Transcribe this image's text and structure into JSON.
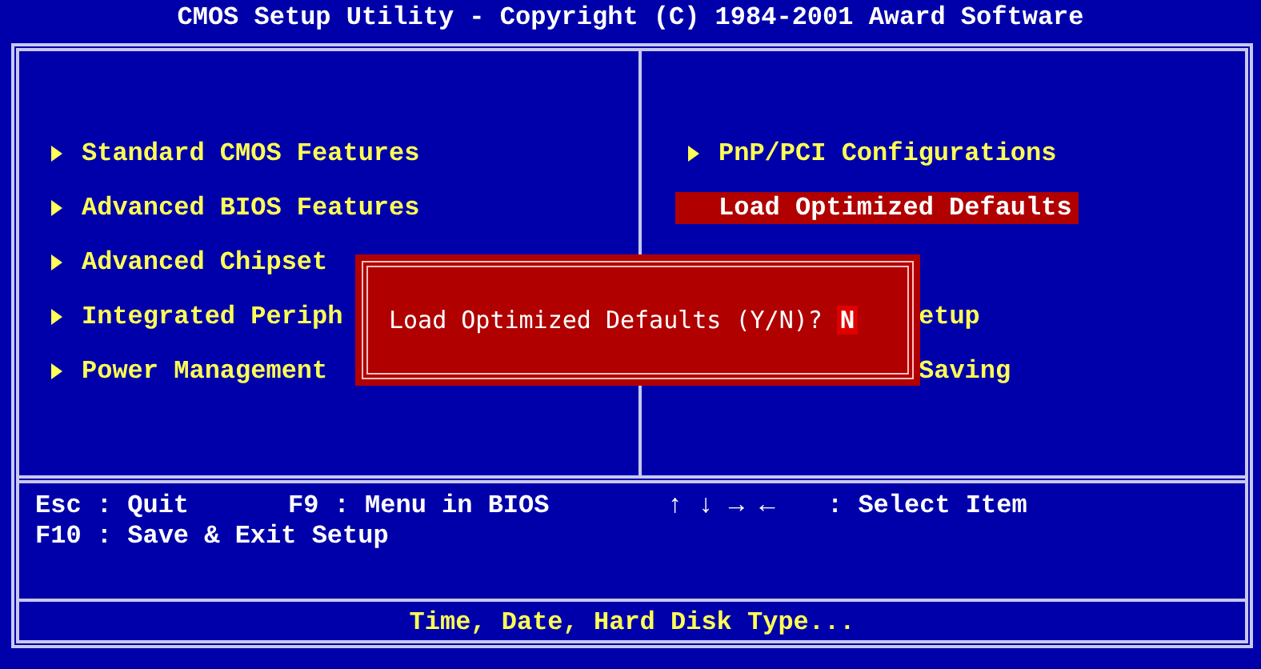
{
  "title": "CMOS Setup Utility - Copyright (C) 1984-2001 Award Software",
  "menu": {
    "left": [
      {
        "label": "Standard CMOS Features",
        "selected": false,
        "kind": "item"
      },
      {
        "label": "Advanced BIOS Features",
        "selected": false,
        "kind": "item"
      },
      {
        "label": "Advanced Chipset",
        "selected": false,
        "kind": "item"
      },
      {
        "label": "Integrated Periph",
        "selected": false,
        "kind": "item"
      },
      {
        "label": "Power Management",
        "selected": false,
        "kind": "item"
      }
    ],
    "right": [
      {
        "label": "PnP/PCI Configurations",
        "selected": false,
        "kind": "item"
      },
      {
        "label": "Load Optimized Defaults",
        "selected": true,
        "kind": "item"
      },
      {
        "kind": "blank"
      },
      {
        "label": "etup",
        "kind": "clipped"
      },
      {
        "label": "Saving",
        "kind": "clipped"
      }
    ]
  },
  "dialog": {
    "prompt": "Load Optimized Defaults (Y/N)?",
    "answer": "N"
  },
  "help": [
    [
      "Esc : Quit",
      "F9 : Menu in BIOS",
      "↑ ↓ → ←",
      ": Select Item"
    ],
    [
      "F10 : Save & Exit Setup"
    ]
  ],
  "status": "Time, Date, Hard Disk Type..."
}
